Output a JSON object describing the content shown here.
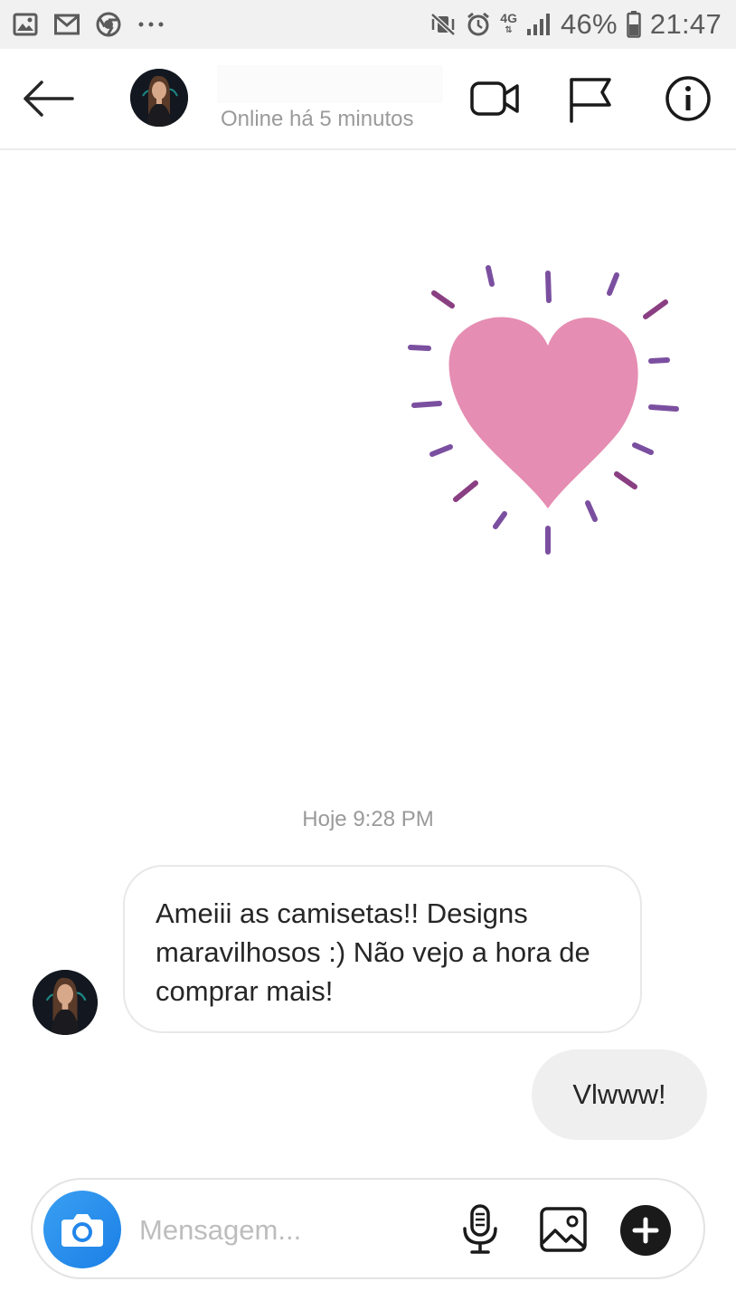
{
  "status_bar": {
    "left_icons": [
      "gallery-icon",
      "gmail-icon",
      "chrome-icon",
      "more-icon"
    ],
    "network": "4G",
    "battery": "46%",
    "time": "21:47"
  },
  "header": {
    "status": "Online há 5 minutos",
    "icons": [
      "back-arrow-icon",
      "video-call-icon",
      "flag-icon",
      "info-icon"
    ]
  },
  "chat": {
    "sticker": "heart-sticker",
    "timestamp": "Hoje 9:28 PM",
    "messages": [
      {
        "direction": "incoming",
        "text": "Ameiii as camisetas!! Designs maravilhosos :) Não vejo a hora de comprar mais!"
      },
      {
        "direction": "outgoing",
        "text": "Vlwww!"
      }
    ]
  },
  "composer": {
    "placeholder": "Mensagem...",
    "icons": [
      "camera-icon",
      "microphone-icon",
      "image-icon",
      "plus-icon"
    ]
  },
  "colors": {
    "heart": "#e58db2",
    "rays": "#7b4fa0",
    "camera_button": "#2a8ff0",
    "outgoing_bubble": "#efefef"
  }
}
